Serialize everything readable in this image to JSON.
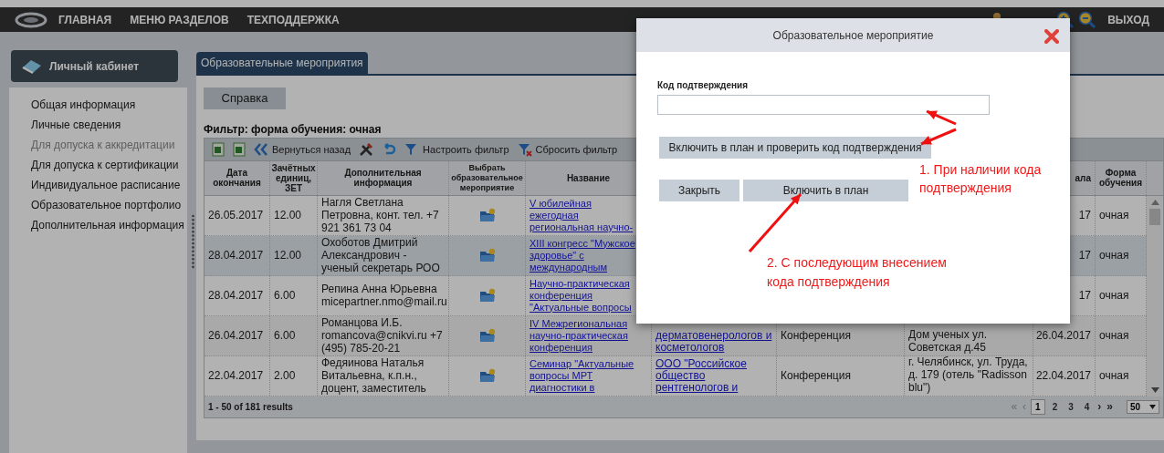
{
  "nav": {
    "items": [
      "ГЛАВНАЯ",
      "МЕНЮ РАЗДЕЛОВ",
      "ТЕХПОДДЕРЖКА"
    ],
    "exit": "ВЫХОД"
  },
  "sidebar": {
    "title": "Личный кабинет",
    "items": [
      {
        "label": "Общая информация",
        "selected": false
      },
      {
        "label": "Личные сведения",
        "selected": false
      },
      {
        "label": "Для допуска к аккредитации",
        "selected": true
      },
      {
        "label": "Для допуска к сертификации",
        "selected": false
      },
      {
        "label": "Индивидуальное расписание",
        "selected": false
      },
      {
        "label": "Образовательное портфолио",
        "selected": false
      },
      {
        "label": "Дополнительная информация",
        "selected": false
      }
    ]
  },
  "tab": {
    "label": "Образовательные мероприятия"
  },
  "help_button": "Справка",
  "filter_label": "Фильтр: форма обучения: очная",
  "toolbar": [
    {
      "kind": "excel"
    },
    {
      "kind": "excel"
    },
    {
      "kind": "back",
      "label": "Вернуться назад"
    },
    {
      "kind": "tools"
    },
    {
      "kind": "undo"
    },
    {
      "kind": "filter",
      "label": "Настроить фильтр"
    },
    {
      "kind": "reset",
      "label": "Сбросить фильтр"
    }
  ],
  "table": {
    "columns": [
      {
        "label": "Дата окончания"
      },
      {
        "label": "Зачётных единиц, ЗЕТ"
      },
      {
        "label": "Дополнительная информация"
      },
      {
        "label": "Выбрать образовательное мероприятие"
      },
      {
        "label": "Название"
      },
      {},
      {},
      {},
      {
        "label": "ала"
      },
      {
        "label": "Форма обучения"
      }
    ],
    "rows": [
      {
        "selected": false,
        "end_date": "26.05.2017",
        "credits": "12.00",
        "info": "Нагля Светлана Петровна, конт. тел. +7 921 361 73 04",
        "name": "V юбилейная ежегодная региональная научно-",
        "start_date": "17",
        "form": "очная"
      },
      {
        "selected": true,
        "end_date": "28.04.2017",
        "credits": "12.00",
        "info": "Охоботов Дмитрий Александрович - ученый секретарь РОО",
        "name": "XIII конгресс \"Мужское здоровье\" с международным",
        "start_date": "17",
        "form": "очная"
      },
      {
        "selected": false,
        "end_date": "28.04.2017",
        "credits": "6.00",
        "info": "Репина Анна Юрьевна micepartner.nmo@mail.ru",
        "name": "Научно-практическая конференция \"Актуальные вопросы",
        "start_date": "17",
        "form": "очная"
      },
      {
        "selected": false,
        "end_date": "26.04.2017",
        "credits": "6.00",
        "info": "Романцова И.Б. romancova@cnikvi.ru +7 (495) 785-20-21",
        "name": "IV Межрегиональная научно-практическая конференция",
        "organizer": "дерматовенерологов и косметологов",
        "type": "Конференция",
        "place": "Дом ученых ул. Советская д.45",
        "start_date": "26.04.2017",
        "form": "очная"
      },
      {
        "selected": false,
        "end_date": "22.04.2017",
        "credits": "2.00",
        "info": "Федяинова Наталья Витальевна, к.п.н., доцент, заместитель",
        "name": "Семинар \"Актуальные вопросы МРТ диагностики в",
        "organizer": "ООО \"Российское общество рентгенологов и",
        "type": "Конференция",
        "place": "г. Челябинск, ул. Труда, д. 179 (отель \"Radisson blu\")",
        "start_date": "22.04.2017",
        "form": "очная"
      }
    ],
    "results": "1 - 50 of 181 results",
    "pager": {
      "first": "«",
      "prev": "‹",
      "next": "›",
      "last": "»",
      "pages": [
        {
          "label": "1",
          "selected": true
        },
        {
          "label": "2",
          "selected": false
        },
        {
          "label": "3",
          "selected": false
        },
        {
          "label": "4",
          "selected": false
        }
      ],
      "per_page": "50"
    }
  },
  "modal": {
    "title": "Образовательное мероприятие",
    "code_label": "Код подтверждения",
    "check_button": "Включить в план и проверить код подтверждения",
    "close_button": "Закрыть",
    "include_button": "Включить в план",
    "annotations": [
      "1. При наличии кода подтверждения",
      "2. С последующим внесением кода подтверждения"
    ]
  }
}
